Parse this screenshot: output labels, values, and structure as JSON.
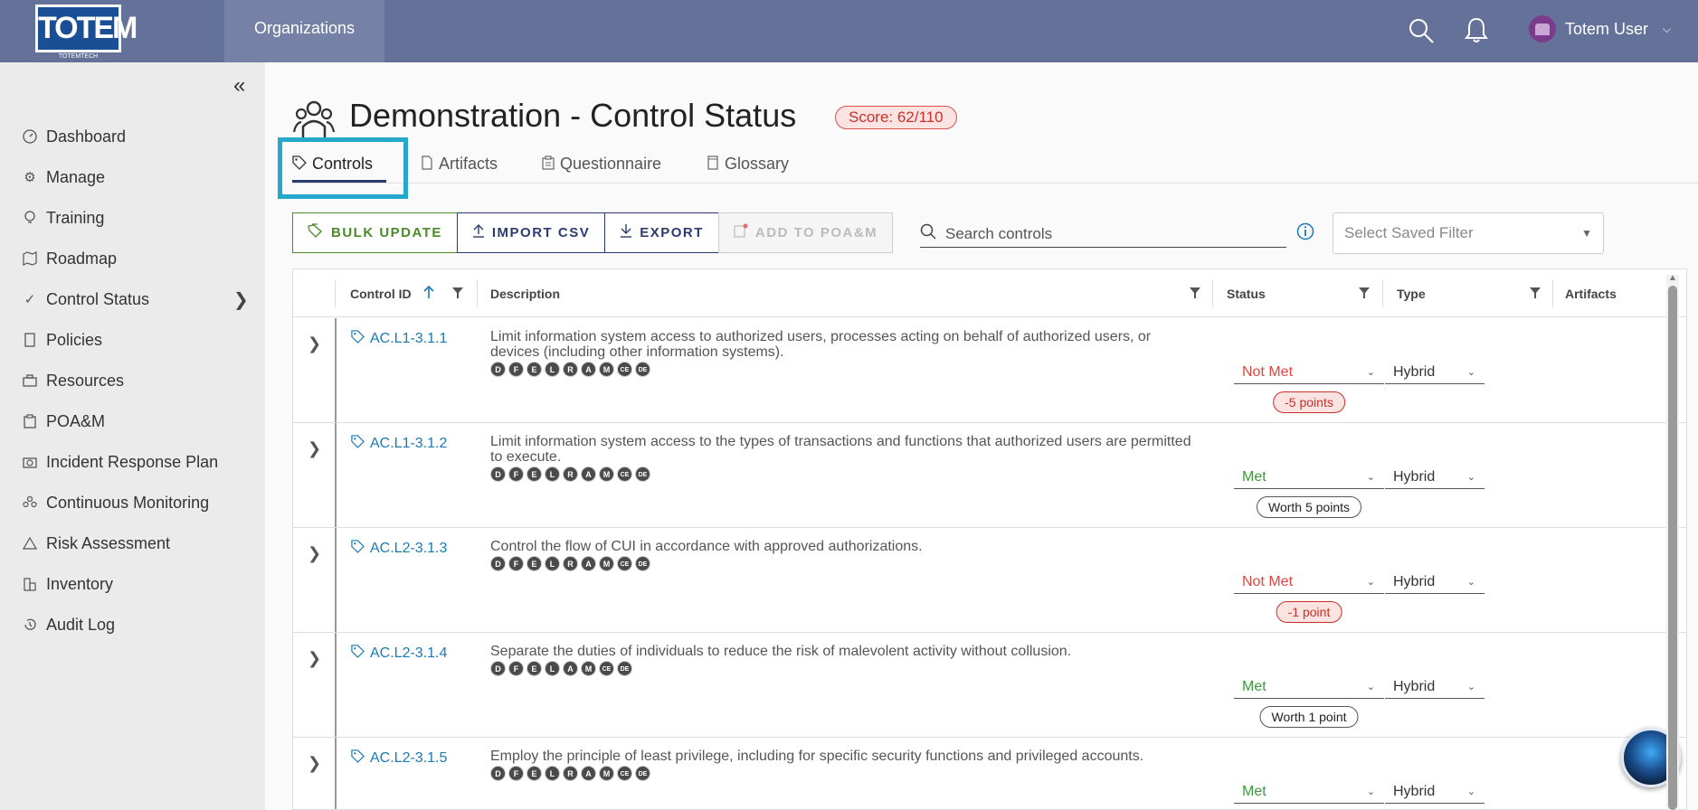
{
  "header": {
    "logo_text": "TOTEM",
    "logo_sub": "TOTEMTECH",
    "org_tab": "Organizations",
    "user_name": "Totem User"
  },
  "sidebar": {
    "items": [
      {
        "label": "Dashboard",
        "icon": "dashboard-icon"
      },
      {
        "label": "Manage",
        "icon": "gear-icon"
      },
      {
        "label": "Training",
        "icon": "lightbulb-icon"
      },
      {
        "label": "Roadmap",
        "icon": "map-icon"
      },
      {
        "label": "Control Status",
        "icon": "check-icon"
      },
      {
        "label": "Policies",
        "icon": "document-icon"
      },
      {
        "label": "Resources",
        "icon": "briefcase-icon"
      },
      {
        "label": "POA&M",
        "icon": "clipboard-icon"
      },
      {
        "label": "Incident Response Plan",
        "icon": "camera-icon"
      },
      {
        "label": "Continuous Monitoring",
        "icon": "people-icon"
      },
      {
        "label": "Risk Assessment",
        "icon": "warning-icon"
      },
      {
        "label": "Inventory",
        "icon": "building-icon"
      },
      {
        "label": "Audit Log",
        "icon": "history-icon"
      }
    ]
  },
  "page": {
    "title": "Demonstration - Control Status",
    "score": "Score: 62/110"
  },
  "tabs": [
    {
      "label": "Controls"
    },
    {
      "label": "Artifacts"
    },
    {
      "label": "Questionnaire"
    },
    {
      "label": "Glossary"
    }
  ],
  "toolbar": {
    "bulk_update": "BULK UPDATE",
    "import_csv": "IMPORT CSV",
    "export": "EXPORT",
    "add_poam": "ADD TO POA&M",
    "search_placeholder": "Search controls",
    "saved_filter_placeholder": "Select Saved Filter"
  },
  "table": {
    "columns": {
      "control_id": "Control ID",
      "description": "Description",
      "status": "Status",
      "type": "Type",
      "artifacts": "Artifacts"
    },
    "rows": [
      {
        "id": "AC.L1-3.1.1",
        "description": "Limit information system access to authorized users, processes acting on behalf of authorized users, or devices (including other information systems).",
        "badges": [
          "D",
          "F",
          "E",
          "L",
          "R",
          "A",
          "M",
          "CE",
          "DE"
        ],
        "status": "Not Met",
        "points": "-5 points",
        "type": "Hybrid"
      },
      {
        "id": "AC.L1-3.1.2",
        "description": "Limit information system access to the types of transactions and functions that authorized users are permitted to execute.",
        "badges": [
          "D",
          "F",
          "E",
          "L",
          "R",
          "A",
          "M",
          "CE",
          "DE"
        ],
        "status": "Met",
        "points": "Worth 5 points",
        "type": "Hybrid"
      },
      {
        "id": "AC.L2-3.1.3",
        "description": "Control the flow of CUI in accordance with approved authorizations.",
        "badges": [
          "D",
          "F",
          "E",
          "L",
          "R",
          "A",
          "M",
          "CE",
          "DE"
        ],
        "status": "Not Met",
        "points": "-1 point",
        "type": "Hybrid"
      },
      {
        "id": "AC.L2-3.1.4",
        "description": "Separate the duties of individuals to reduce the risk of malevolent activity without collusion.",
        "badges": [
          "D",
          "F",
          "E",
          "L",
          "A",
          "M",
          "CE",
          "DE"
        ],
        "status": "Met",
        "points": "Worth 1 point",
        "type": "Hybrid"
      },
      {
        "id": "AC.L2-3.1.5",
        "description": "Employ the principle of least privilege, including for specific security functions and privileged accounts.",
        "badges": [
          "D",
          "F",
          "E",
          "L",
          "R",
          "A",
          "M",
          "CE",
          "DE"
        ],
        "status": "Met",
        "points": "",
        "type": "Hybrid"
      }
    ]
  },
  "colors": {
    "topbar": "#647299",
    "met": "#3a9a3a",
    "not_met": "#e0443e",
    "link": "#1a7ab5",
    "highlight": "#26a8cc"
  }
}
